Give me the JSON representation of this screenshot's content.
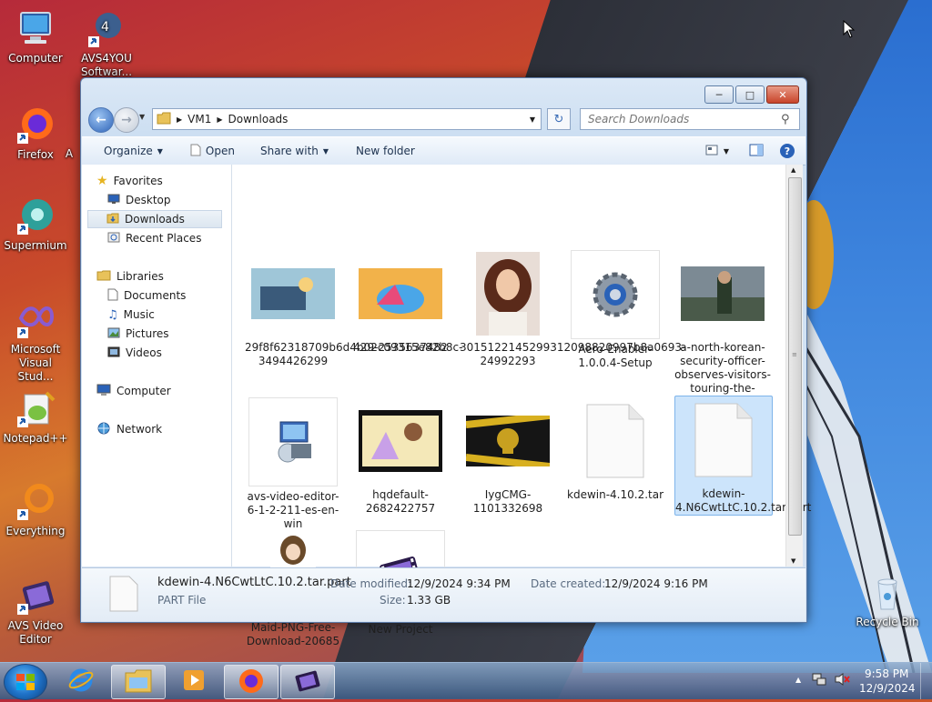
{
  "desktop": {
    "icons": [
      {
        "label": "Computer"
      },
      {
        "label": "AVS4YOU Softwar..."
      },
      {
        "label": "Firefox"
      },
      {
        "label": "Supermium"
      },
      {
        "label": "Microsoft Visual Stud..."
      },
      {
        "label": "Notepad++"
      },
      {
        "label": "Everything"
      },
      {
        "label": "AVS Video Editor"
      },
      {
        "label": "Recycle Bin"
      }
    ],
    "partial_label": "A"
  },
  "window": {
    "address": {
      "root": "VM1",
      "folder": "Downloads"
    },
    "search_placeholder": "Search Downloads",
    "toolbar": {
      "organize": "Organize",
      "open": "Open",
      "share_with": "Share with",
      "new_folder": "New folder"
    },
    "nav": {
      "favorites": "Favorites",
      "desktop": "Desktop",
      "downloads": "Downloads",
      "recent_places": "Recent Places",
      "libraries": "Libraries",
      "documents": "Documents",
      "music": "Music",
      "pictures": "Pictures",
      "videos": "Videos",
      "computer": "Computer",
      "network": "Network"
    },
    "files": [
      {
        "name": "29f8f62318709b6d4b02c09315e82b8c-3494426299"
      },
      {
        "name": "429-2535637482"
      },
      {
        "name": "3015122145299312098820997b8a0693-24992293"
      },
      {
        "name": "Aero-Enabler-1.0.0.4-Setup"
      },
      {
        "name": "a-north-korean-security-officer-observes-visitors-touring-the-unit..."
      },
      {
        "name": "avs-video-editor-6-1-2-211-es-en-win"
      },
      {
        "name": "hqdefault-2682422757"
      },
      {
        "name": "IygCMG-1101332698"
      },
      {
        "name": "kdewin-4.10.2.tar"
      },
      {
        "name": "kdewin-4.N6CwtLtC.10.2.tar.part"
      },
      {
        "name": "Maid-PNG-Free-Download-20685"
      },
      {
        "name": "New Project"
      }
    ],
    "details": {
      "filename": "kdewin-4.N6CwtLtC.10.2.tar.part",
      "type": "PART File",
      "modified_label": "Date modified:",
      "modified_value": "12/9/2024 9:34 PM",
      "created_label": "Date created:",
      "created_value": "12/9/2024 9:16 PM",
      "size_label": "Size:",
      "size_value": "1.33 GB"
    }
  },
  "taskbar": {
    "time": "9:58 PM",
    "date": "12/9/2024"
  }
}
